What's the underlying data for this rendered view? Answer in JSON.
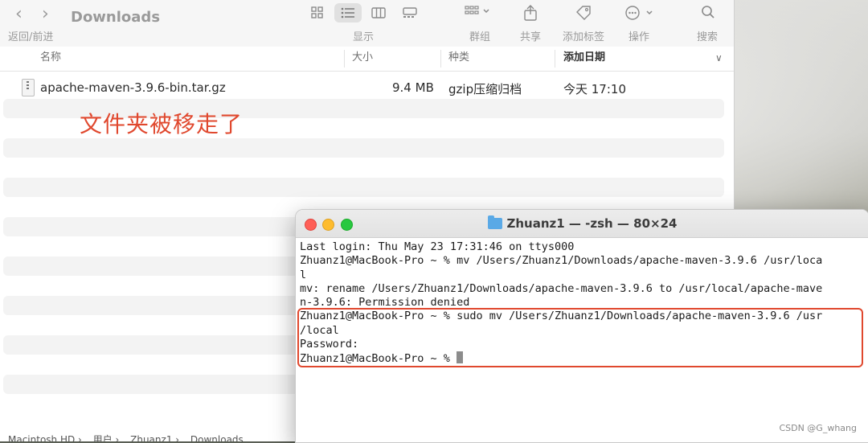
{
  "finder": {
    "title": "Downloads",
    "nav_label": "返回/前进",
    "toolbar": {
      "view_label": "显示",
      "group_label": "群组",
      "share_label": "共享",
      "tag_label": "添加标签",
      "action_label": "操作",
      "search_label": "搜索"
    },
    "columns": {
      "name": "名称",
      "size": "大小",
      "kind": "种类",
      "date": "添加日期"
    },
    "file": {
      "name": "apache-maven-3.9.6-bin.tar.gz",
      "size": "9.4 MB",
      "kind": "gzip压缩归档",
      "date": "今天 17:10"
    },
    "annotation": "文件夹被移走了",
    "pathbar": {
      "items": [
        "Macintosh HD",
        "用户",
        "Zhuanz1",
        "Downloads"
      ]
    }
  },
  "terminal": {
    "title": "Zhuanz1 — -zsh — 80×24",
    "lines": [
      "Last login: Thu May 23 17:31:46 on ttys000",
      "Zhuanz1@MacBook-Pro ~ % mv /Users/Zhuanz1/Downloads/apache-maven-3.9.6 /usr/loca",
      "l",
      "mv: rename /Users/Zhuanz1/Downloads/apache-maven-3.9.6 to /usr/local/apache-mave",
      "n-3.9.6: Permission denied",
      "Zhuanz1@MacBook-Pro ~ % sudo mv /Users/Zhuanz1/Downloads/apache-maven-3.9.6 /usr",
      "/local",
      "Password:",
      "Zhuanz1@MacBook-Pro ~ % "
    ]
  },
  "watermark": "CSDN @G_whang",
  "colors": {
    "annotation": "#e0482e",
    "highlight_border": "#e0482e",
    "close": "#ff5f57",
    "minimize": "#febc2e",
    "zoom": "#28c840"
  }
}
